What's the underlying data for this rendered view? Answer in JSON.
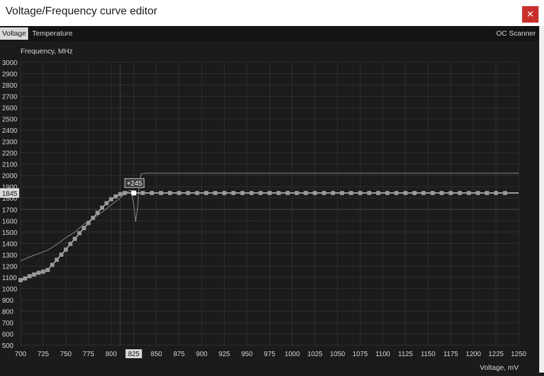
{
  "window": {
    "title": "Voltage/Frequency curve editor",
    "close_glyph": "✕"
  },
  "tabs": {
    "voltage": "Voltage",
    "temperature": "Temperature",
    "oc_scanner": "OC Scanner"
  },
  "colors": {
    "accent_close": "#c9302c",
    "background": "#1b1b1b",
    "grid": "#333333",
    "curve": "#9a9a9a"
  },
  "chart_data": {
    "type": "line",
    "ylabel": "Frequency, MHz",
    "xlabel": "Voltage, mV",
    "xlim": [
      700,
      1250
    ],
    "ylim": [
      500,
      3000
    ],
    "xticks": [
      700,
      725,
      750,
      775,
      800,
      825,
      850,
      875,
      900,
      925,
      950,
      975,
      1000,
      1025,
      1050,
      1075,
      1100,
      1125,
      1150,
      1175,
      1200,
      1225,
      1250
    ],
    "yticks": [
      500,
      600,
      700,
      800,
      900,
      1000,
      1100,
      1200,
      1300,
      1400,
      1500,
      1600,
      1700,
      1800,
      1900,
      2000,
      2100,
      2200,
      2300,
      2400,
      2500,
      2600,
      2700,
      2800,
      2900,
      3000
    ],
    "grid": true,
    "selected_voltage": 825,
    "selected_frequency": 1845,
    "offset_label": "+245",
    "current_frequency_label": "1845",
    "series": [
      {
        "points": [
          [
            700,
            1075
          ],
          [
            705,
            1090
          ],
          [
            710,
            1110
          ],
          [
            715,
            1125
          ],
          [
            720,
            1140
          ],
          [
            725,
            1150
          ],
          [
            730,
            1165
          ],
          [
            735,
            1210
          ],
          [
            740,
            1255
          ],
          [
            745,
            1300
          ],
          [
            750,
            1345
          ],
          [
            755,
            1395
          ],
          [
            760,
            1440
          ],
          [
            765,
            1490
          ],
          [
            770,
            1535
          ],
          [
            775,
            1580
          ],
          [
            780,
            1625
          ],
          [
            785,
            1670
          ],
          [
            790,
            1715
          ],
          [
            795,
            1755
          ],
          [
            800,
            1790
          ],
          [
            805,
            1815
          ],
          [
            810,
            1835
          ],
          [
            815,
            1845
          ],
          [
            825,
            1845
          ],
          [
            835,
            1845
          ],
          [
            845,
            1845
          ],
          [
            855,
            1845
          ],
          [
            865,
            1845
          ],
          [
            875,
            1845
          ],
          [
            885,
            1845
          ],
          [
            895,
            1845
          ],
          [
            905,
            1845
          ],
          [
            915,
            1845
          ],
          [
            925,
            1845
          ],
          [
            935,
            1845
          ],
          [
            945,
            1845
          ],
          [
            955,
            1845
          ],
          [
            965,
            1845
          ],
          [
            975,
            1845
          ],
          [
            985,
            1845
          ],
          [
            995,
            1845
          ],
          [
            1005,
            1845
          ],
          [
            1015,
            1845
          ],
          [
            1025,
            1845
          ],
          [
            1035,
            1845
          ],
          [
            1045,
            1845
          ],
          [
            1055,
            1845
          ],
          [
            1065,
            1845
          ],
          [
            1075,
            1845
          ],
          [
            1085,
            1845
          ],
          [
            1095,
            1845
          ],
          [
            1105,
            1845
          ],
          [
            1115,
            1845
          ],
          [
            1125,
            1845
          ],
          [
            1135,
            1845
          ],
          [
            1145,
            1845
          ],
          [
            1155,
            1845
          ],
          [
            1165,
            1845
          ],
          [
            1175,
            1845
          ],
          [
            1185,
            1845
          ],
          [
            1195,
            1845
          ],
          [
            1205,
            1845
          ],
          [
            1215,
            1845
          ],
          [
            1225,
            1845
          ],
          [
            1235,
            1845
          ]
        ]
      },
      {
        "points": [
          [
            700,
            1245
          ],
          [
            710,
            1280
          ],
          [
            720,
            1310
          ],
          [
            730,
            1340
          ],
          [
            740,
            1390
          ],
          [
            750,
            1450
          ],
          [
            760,
            1500
          ],
          [
            770,
            1570
          ],
          [
            780,
            1620
          ],
          [
            790,
            1675
          ],
          [
            800,
            1740
          ],
          [
            810,
            1800
          ],
          [
            818,
            1860
          ],
          [
            822,
            1870
          ],
          [
            824,
            1790
          ],
          [
            826,
            1680
          ],
          [
            827,
            1590
          ],
          [
            829,
            1700
          ],
          [
            831,
            1900
          ],
          [
            833,
            2015
          ],
          [
            840,
            2020
          ],
          [
            900,
            2020
          ],
          [
            1000,
            2020
          ],
          [
            1100,
            2020
          ],
          [
            1200,
            2020
          ],
          [
            1250,
            2020
          ]
        ]
      }
    ]
  }
}
